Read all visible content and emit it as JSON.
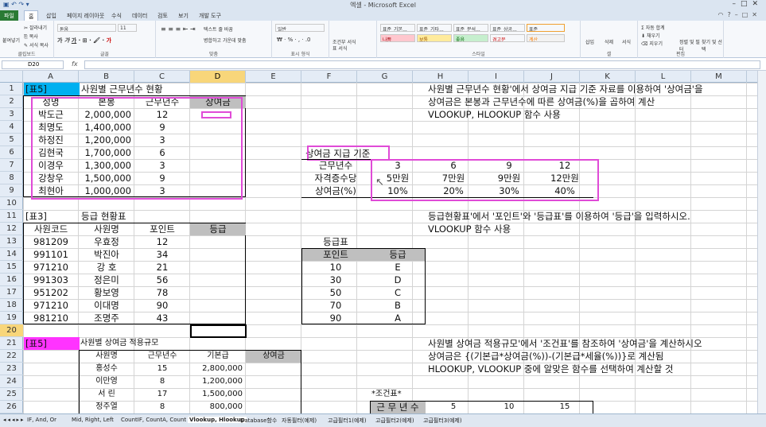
{
  "window": {
    "title": "엑셀 - Microsoft Excel"
  },
  "tabs": [
    "파일",
    "홈",
    "삽입",
    "페이지 레이아웃",
    "수식",
    "데이터",
    "검토",
    "보기",
    "개발 도구"
  ],
  "ribbon": {
    "clipboard": {
      "paste": "붙여넣기",
      "cut": "잘라내기",
      "copy": "복사",
      "format_painter": "서식 복사",
      "label": "클립보드"
    },
    "font": {
      "name": "돋움",
      "size": "11",
      "label": "글꼴"
    },
    "alignment": {
      "wrap": "텍스트 줄 바꿈",
      "merge": "병합하고 가운데 맞춤",
      "label": "맞춤"
    },
    "number": {
      "format": "일반",
      "label": "표시 형식"
    },
    "cond": {
      "conditional": "조건부 서식",
      "table": "표 서식"
    },
    "styles": {
      "items": [
        "표준_기본...",
        "표준_기타...",
        "표준_분석...",
        "표준_상공...",
        "표준",
        "나쁨",
        "보통",
        "좋음",
        "경고문",
        "계산"
      ],
      "label": "스타일"
    },
    "cells": {
      "insert": "삽입",
      "delete": "삭제",
      "format": "서식",
      "label": "셀"
    },
    "editing": {
      "autosum": "자동 합계",
      "fill": "채우기",
      "clear": "지우기",
      "sort": "정렬 및 필터",
      "find": "찾기 및 선택",
      "label": "편집"
    }
  },
  "formula_bar": {
    "name_box": "D20",
    "fx": "fx",
    "value": ""
  },
  "columns": [
    "A",
    "B",
    "C",
    "D",
    "E",
    "F",
    "G",
    "H",
    "I",
    "J",
    "K",
    "L",
    "M"
  ],
  "selected_column": "D",
  "rows": [
    "1",
    "2",
    "3",
    "4",
    "5",
    "6",
    "7",
    "8",
    "9",
    "10",
    "11",
    "12",
    "13",
    "14",
    "15",
    "16",
    "17",
    "18",
    "19",
    "20",
    "21",
    "22",
    "23",
    "24",
    "25",
    "26"
  ],
  "selected_row": "20",
  "sheet": {
    "t1_label": "[표5]",
    "t1_title": "사원별 근무년수 현황",
    "t1_headers": [
      "성명",
      "본봉",
      "근무년수",
      "상여금"
    ],
    "t1_rows": [
      [
        "박도근",
        "2,000,000",
        "12"
      ],
      [
        "최명도",
        "1,400,000",
        "9"
      ],
      [
        "하정진",
        "1,200,000",
        "3"
      ],
      [
        "김현국",
        "1,700,000",
        "6"
      ],
      [
        "이경우",
        "1,300,000",
        "3"
      ],
      [
        "강창우",
        "1,500,000",
        "9"
      ],
      [
        "최현아",
        "1,000,000",
        "3"
      ]
    ],
    "note1": [
      "사원별 근무년수 현황'에서 상여금 지급 기준 자료를 이용하여 '상여금'을",
      "상여금은 본봉과 근무년수에 따른 상여금(%)을 곱하여 계산",
      "VLOOKUP, HLOOKUP 함수 사용"
    ],
    "crit_title": "상여금 지급 기준",
    "crit_rows": [
      [
        "근무년수",
        "3",
        "6",
        "9",
        "12"
      ],
      [
        "자격증수당",
        "5만원",
        "7만원",
        "9만원",
        "12만원"
      ],
      [
        "상여금(%)",
        "10%",
        "20%",
        "30%",
        "40%"
      ]
    ],
    "t2_label": "[표3]",
    "t2_title": "등급 현황표",
    "t2_headers": [
      "사원코드",
      "사원명",
      "포인트",
      "등급"
    ],
    "t2_rows": [
      [
        "981209",
        "우효정",
        "12"
      ],
      [
        "991101",
        "박진아",
        "34"
      ],
      [
        "971210",
        "강  호",
        "21"
      ],
      [
        "991303",
        "정은미",
        "56"
      ],
      [
        "951202",
        "황보영",
        "78"
      ],
      [
        "971210",
        "이대명",
        "90"
      ],
      [
        "981210",
        "조명주",
        "43"
      ]
    ],
    "note2": [
      "등급현황표'에서 '포인트'와 '등급표'를 이용하여 '등급'을 입력하시오.",
      "VLOOKUP 함수 사용"
    ],
    "grade_title": "등급표",
    "grade_headers": [
      "포인트",
      "등급"
    ],
    "grade_rows": [
      [
        "10",
        "E"
      ],
      [
        "30",
        "D"
      ],
      [
        "50",
        "C"
      ],
      [
        "70",
        "B"
      ],
      [
        "90",
        "A"
      ]
    ],
    "t3_label": "[표5]",
    "t3_title": "사원별 상여금 적용규모",
    "t3_headers": [
      "사원명",
      "근무년수",
      "기본급",
      "상여금"
    ],
    "t3_rows": [
      [
        "홍성수",
        "15",
        "2,800,000"
      ],
      [
        "이만영",
        "8",
        "1,200,000"
      ],
      [
        "서  린",
        "17",
        "1,500,000"
      ],
      [
        "정주열",
        "8",
        "800,000"
      ]
    ],
    "note3": [
      "사원별 상여금 적용규모'에서 '조건표'를 참조하여 '상여금'을 계산하시오",
      "상여금은 {(기본급*상여금(%))-(기본급*세율(%))}로 계산됨",
      "HLOOKUP, VLOOKUP 중에 알맞은 함수를 선택하여 계산할 것"
    ],
    "cond_title": "*조건표*",
    "cond_row": [
      "근 무 년 수",
      "5",
      "10",
      "15"
    ]
  },
  "sheet_tabs": [
    "IF, And, Or",
    "Mid, Right, Left",
    "CountIF, CountA, Count",
    "Vlookup, Hlookup",
    "Database함수",
    "자동필터(예제)",
    "고급필터1(예제)",
    "고급필터2(예제)",
    "고급필터3(예제)"
  ],
  "active_sheet": "Vlookup, Hlookup",
  "colors": {
    "t1_label_bg": "#00b0f0",
    "t3_label_bg": "#ff33ff",
    "header_gray": "#bfbfbf",
    "highlight": "#e04bd7",
    "selected_header": "#f8d67a"
  }
}
